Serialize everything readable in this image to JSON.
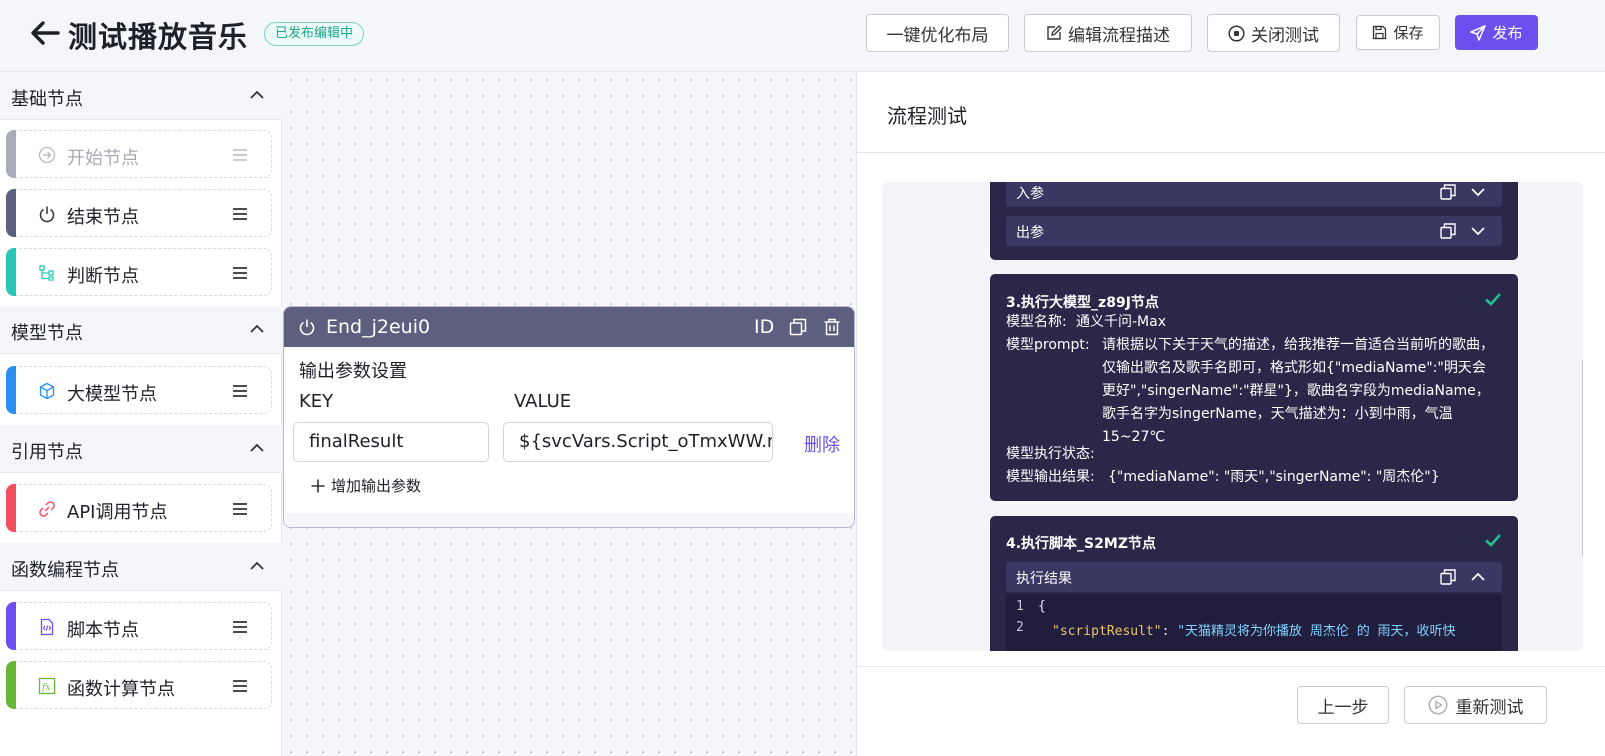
{
  "header": {
    "title": "测试播放音乐",
    "status_badge": "已发布编辑中",
    "buttons": {
      "optimize": "一键优化布局",
      "edit_desc": "编辑流程描述",
      "close_test": "关闭测试",
      "save": "保存",
      "publish": "发布"
    }
  },
  "sidebar": {
    "sections": [
      {
        "title": "基础节点",
        "items": [
          "开始节点",
          "结束节点",
          "判断节点"
        ]
      },
      {
        "title": "模型节点",
        "items": [
          "大模型节点"
        ]
      },
      {
        "title": "引用节点",
        "items": [
          "API调用节点"
        ]
      },
      {
        "title": "函数编程节点",
        "items": [
          "脚本节点",
          "函数计算节点"
        ]
      }
    ]
  },
  "end_node": {
    "title": "End_j2eui0",
    "id_label": "ID",
    "section_label": "输出参数设置",
    "key_header": "KEY",
    "value_header": "VALUE",
    "key_value": "finalResult",
    "value_value": "${svcVars.Script_oTmxWW.res",
    "delete_label": "删除",
    "add_param_label": "增加输出参数"
  },
  "test_panel": {
    "title": "流程测试",
    "card2": {
      "input_label": "入参",
      "output_label": "出参"
    },
    "card3": {
      "title": "3.执行大模型_z89J节点",
      "model_name_key": "模型名称:",
      "model_name_value": "通义千问-Max",
      "prompt_key": "模型prompt:",
      "prompt_value": "请根据以下关于天气的描述，给我推荐一首适合当前听的歌曲，仅输出歌名及歌手名即可，格式形如{\"mediaName\":\"明天会更好\",\"singerName\":\"群星\"}，歌曲名字段为mediaName，歌手名字为singerName，天气描述为：小到中雨，气温15~27℃",
      "status_key": "模型执行状态:",
      "result_key": "模型输出结果:",
      "result_value": "{\"mediaName\": \"雨天\",\"singerName\": \"周杰伦\"}"
    },
    "card4": {
      "title": "4.执行脚本_S2MZ节点",
      "section_label": "执行结果",
      "code_lines": [
        {
          "num": "1",
          "text": "{"
        },
        {
          "num": "2",
          "key": "\"scriptResult\"",
          "sep": ": ",
          "value": "\"天猫精灵将为你播放 周杰伦 的 雨天，收听快"
        }
      ]
    },
    "buttons": {
      "prev": "上一步",
      "retest": "重新测试"
    }
  },
  "colors": {
    "accent": "#6d4fef",
    "success": "#18a88a",
    "card_bg": "#2a2748",
    "node_header": "#5d5f7f",
    "bar_start": "#a9abb8",
    "bar_end": "#5d5f7f",
    "bar_judge": "#2bc7b6",
    "bar_llm": "#2b8ef0",
    "bar_api": "#f2505f",
    "bar_script": "#6d4fef",
    "bar_func": "#6ab637"
  }
}
